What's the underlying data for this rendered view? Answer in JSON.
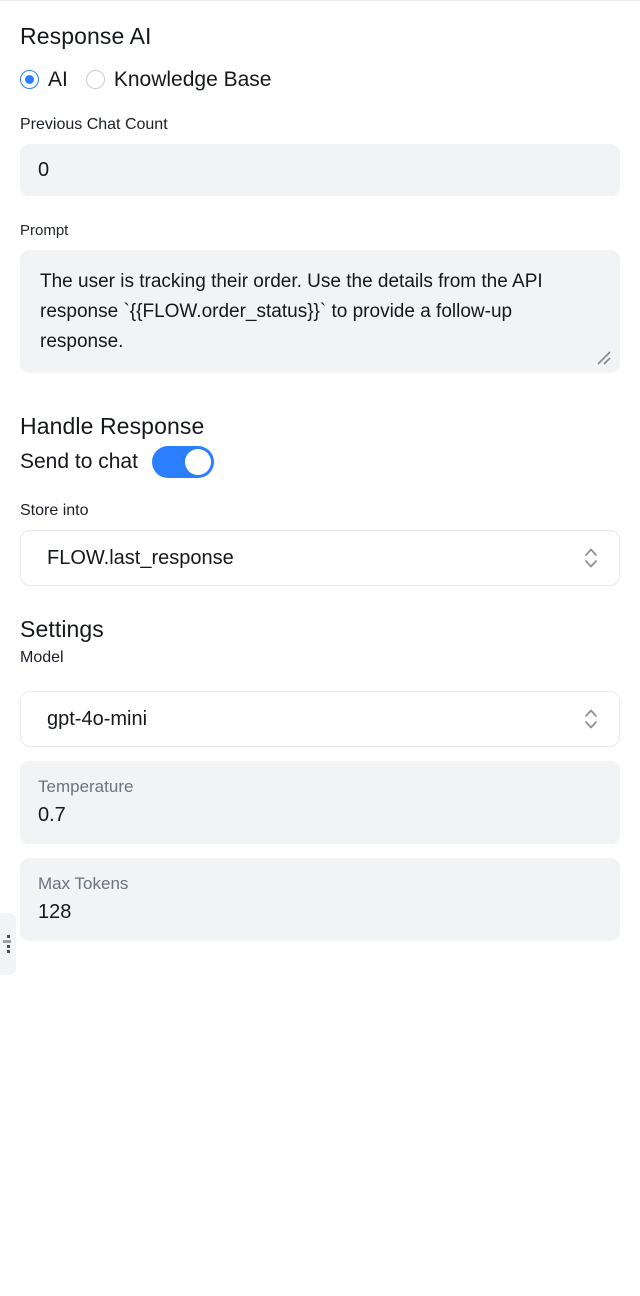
{
  "panel": {
    "response_ai": {
      "title": "Response AI",
      "mode_options": [
        {
          "label": "AI",
          "selected": true
        },
        {
          "label": "Knowledge Base",
          "selected": false
        }
      ],
      "previous_chat_count": {
        "label": "Previous Chat Count",
        "value": "0"
      },
      "prompt": {
        "label": "Prompt",
        "value": "The user is tracking their order. Use the details from the API response `{{FLOW.order_status}}` to provide a follow-up response.",
        "resize_grip_icon": "resize-grip-icon"
      }
    },
    "handle_response": {
      "title": "Handle Response",
      "send_to_chat": {
        "label": "Send to chat",
        "enabled": true
      },
      "store_into": {
        "label": "Store into",
        "value": "FLOW.last_response",
        "chevron_icon": "chevron-up-down-icon"
      }
    },
    "settings": {
      "title": "Settings",
      "model": {
        "label": "Model",
        "value": "gpt-4o-mini",
        "chevron_icon": "chevron-up-down-icon"
      },
      "temperature": {
        "label": "Temperature",
        "value": "0.7"
      },
      "max_tokens": {
        "label": "Max Tokens",
        "value": "128"
      }
    },
    "edge_handle": {
      "icon": "drag-handle-icon"
    },
    "colors": {
      "accent": "#2b7fff",
      "field_bg": "#f2f3f4",
      "border": "#e6e8eb",
      "text": "#14181d",
      "muted_text": "#6b7280"
    }
  }
}
